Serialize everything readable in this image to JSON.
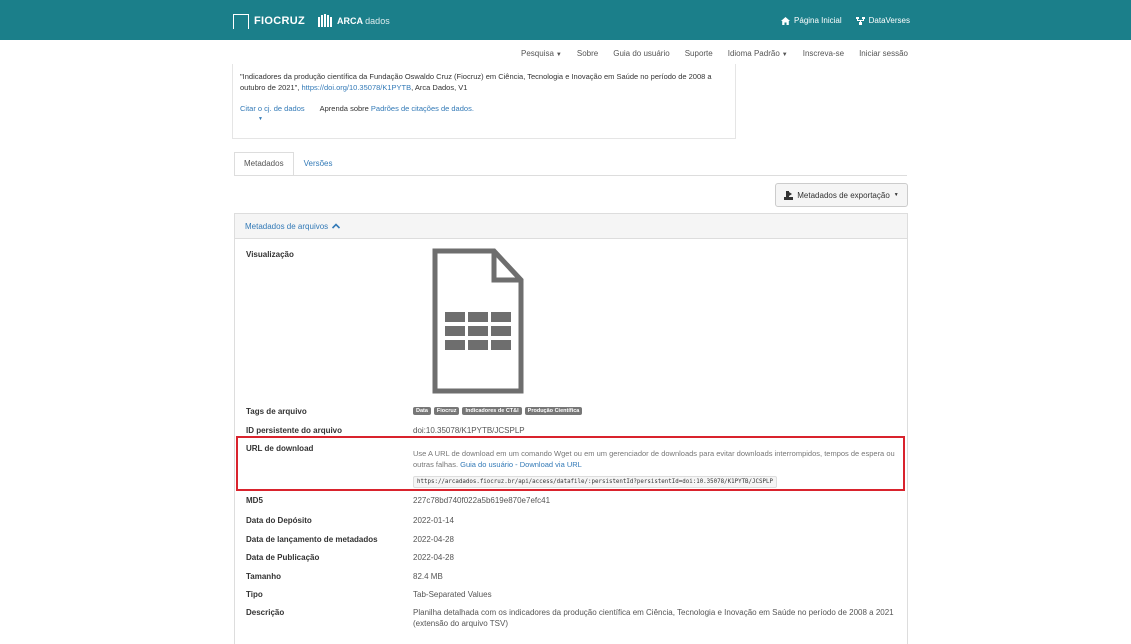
{
  "topbar": {
    "brand_fiocruz": "FIOCRUZ",
    "brand_arca": "ARCA",
    "brand_arca_sub": "dados",
    "home_label": "Página Inicial",
    "dataverses_label": "DataVerses"
  },
  "nav": {
    "items": [
      {
        "label": "Pesquisa",
        "caret": true
      },
      {
        "label": "Sobre"
      },
      {
        "label": "Guia do usuário"
      },
      {
        "label": "Suporte"
      },
      {
        "label": "Idioma Padrão",
        "caret": true
      },
      {
        "label": "Inscreva-se"
      },
      {
        "label": "Iniciar sessão"
      }
    ]
  },
  "citation": {
    "text": "\"Indicadores da produção científica da Fundação Oswaldo Cruz (Fiocruz) em Ciência, Tecnologia e Inovação em Saúde no período de 2008 a outubro de 2021\",",
    "doi": "https://doi.org/10.35078/K1PYTB",
    "suffix": ", Arca Dados, V1",
    "cite_label": "Citar o cj. de dados",
    "learn_prefix": "Aprenda sobre",
    "learn_link": "Padrões de citações de dados."
  },
  "tabs": [
    {
      "label": "Metadados",
      "active": true
    },
    {
      "label": "Versões",
      "active": false
    }
  ],
  "export_label": "Metadados de exportação",
  "panel": {
    "title": "Metadados de arquivos",
    "preview_label": "Visualização",
    "tags_label": "Tags de arquivo",
    "tags": [
      "Data",
      "Fiocruz",
      "Indicadores de CT&I",
      "Produção Científica"
    ],
    "pid_label": "ID persistente do arquivo",
    "pid_value": "doi:10.35078/K1PYTB/JCSPLP",
    "download_label": "URL de download",
    "download_desc": "Use A URL de download em um comando Wget ou em um gerenciador de downloads para evitar downloads interrompidos, tempos de espera ou outras falhas.",
    "download_guide": "Guia do usuário - Download via URL",
    "download_url": "https://arcadados.fiocruz.br/api/access/datafile/:persistentId?persistentId=doi:10.35078/K1PYTB/JCSPLP",
    "md5_label": "MD5",
    "md5_value": "227c78bd740f022a5b619e870e7efc41",
    "deposit_label": "Data do Depósito",
    "deposit_value": "2022-01-14",
    "release_label": "Data de lançamento de metadados",
    "release_value": "2022-04-28",
    "pub_label": "Data de Publicação",
    "pub_value": "2022-04-28",
    "size_label": "Tamanho",
    "size_value": "82.4 MB",
    "type_label": "Tipo",
    "type_value": "Tab-Separated Values",
    "desc_label": "Descrição",
    "desc_value": "Planilha detalhada com os indicadores da produção científica em Ciência, Tecnologia e Inovação em Saúde no período de 2008 a 2021 (extensão do arquivo TSV)"
  },
  "colors": {
    "topbar": "#1b7f8a",
    "link": "#337ab7",
    "highlight": "#d9232d"
  }
}
